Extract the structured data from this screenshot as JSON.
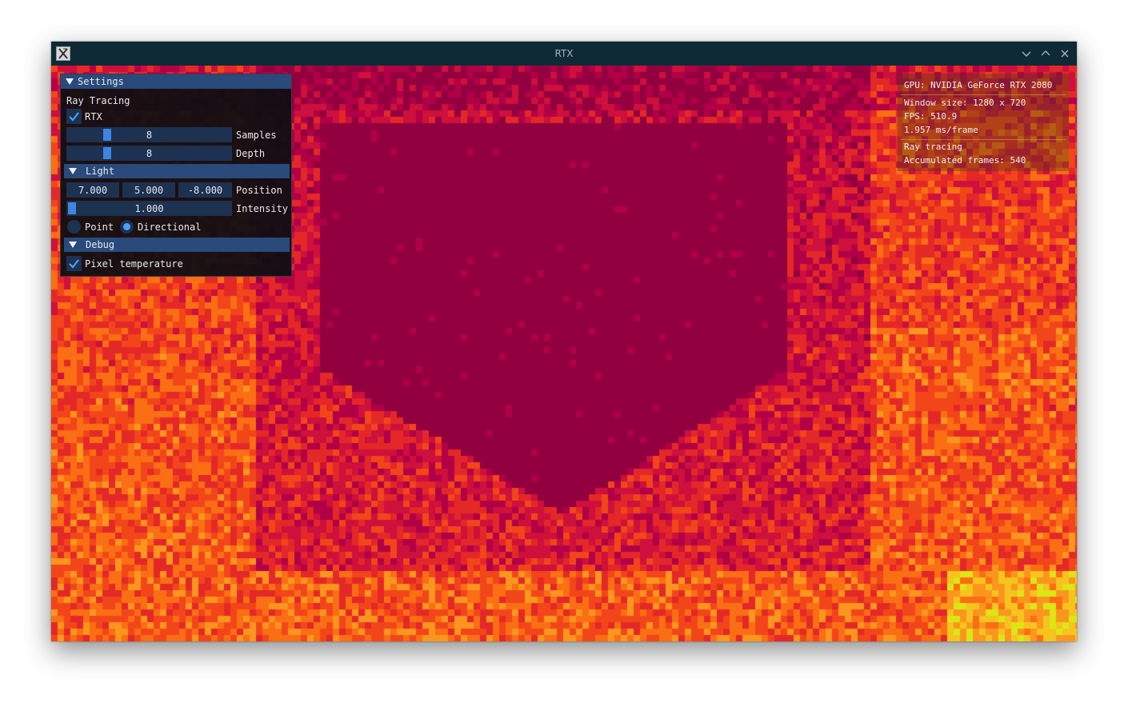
{
  "window": {
    "title": "RTX"
  },
  "settings": {
    "title": "Settings",
    "ray_tracing_heading": "Ray Tracing",
    "rtx_label": "RTX",
    "rtx_checked": true,
    "samples": {
      "value": "8",
      "label": "Samples",
      "fraction": 0.2
    },
    "depth": {
      "value": "8",
      "label": "Depth",
      "fraction": 0.2
    },
    "light": {
      "title": "Light",
      "position": {
        "x": "7.000",
        "y": "5.000",
        "z": "-8.000",
        "label": "Position"
      },
      "intensity": {
        "value": "1.000",
        "label": "Intensity",
        "fraction": 0.0
      },
      "point_label": "Point",
      "directional_label": "Directional",
      "selected": "Directional"
    },
    "debug": {
      "title": "Debug",
      "pixel_temperature_label": "Pixel temperature",
      "pixel_temperature_checked": true
    }
  },
  "stats": {
    "gpu": "GPU: NVIDIA GeForce RTX 2080",
    "window_size": "Window size: 1280 x 720",
    "fps": "FPS: 510.9",
    "frame_time": "1.957 ms/frame",
    "mode": "Ray tracing",
    "accumulated": "Accumulated frames: 540"
  },
  "colors": {
    "titlebar": "#0e2a35",
    "panel_header": "#294a7a",
    "frame_bg": "#1d3150",
    "accent": "#3d85e0",
    "heat_cold": "#92003f",
    "heat_mid": "#e8311a",
    "heat_hot": "#f7c21a"
  },
  "icons": {
    "app": "x-window-icon",
    "minimize": "chevron-down-icon",
    "maximize": "chevron-up-icon",
    "close": "close-icon"
  }
}
